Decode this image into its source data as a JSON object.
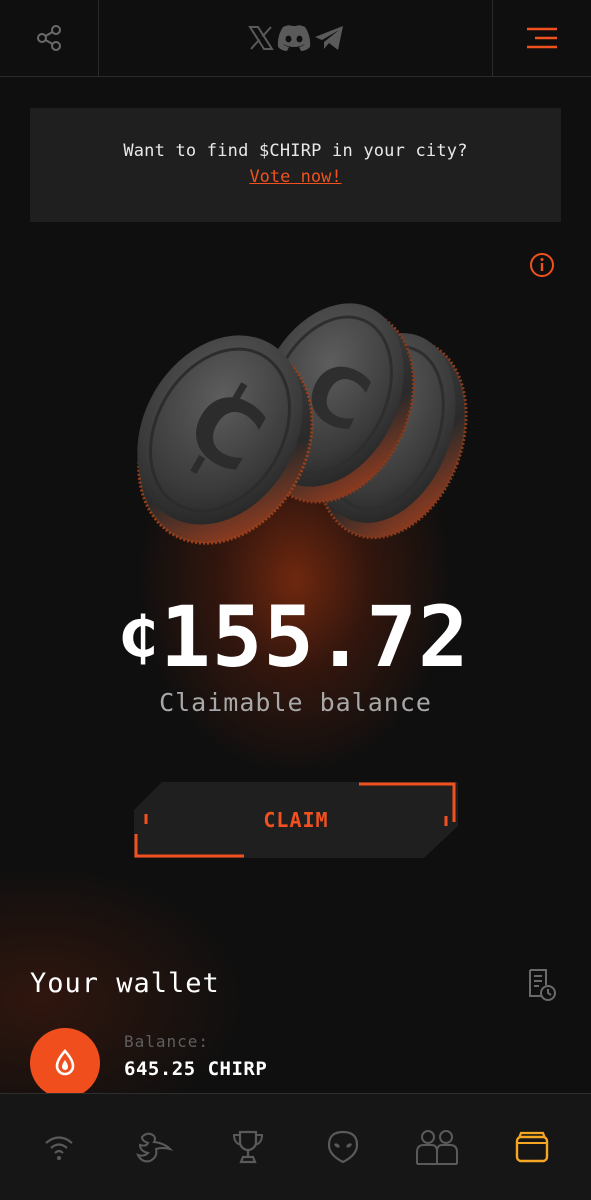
{
  "topbar": {
    "share_icon": "share-icon",
    "social": [
      "x-icon",
      "discord-icon",
      "telegram-icon"
    ],
    "menu_icon": "hamburger-menu-icon"
  },
  "banner": {
    "text": "Want to find $CHIRP in your city?",
    "link": "Vote now!"
  },
  "balance": {
    "symbol": "₵",
    "amount": "155.72",
    "label": "Claimable balance"
  },
  "claim": {
    "label": "CLAIM"
  },
  "wallet": {
    "title": "Your wallet",
    "balance_label": "Balance:",
    "balance_value": "645.25 CHIRP"
  },
  "bottom_nav": [
    "wifi-icon",
    "bird-icon",
    "trophy-icon",
    "alien-icon",
    "people-icon",
    "wallet-icon"
  ],
  "colors": {
    "accent": "#f0511f",
    "background": "#0f0f0f",
    "panel": "#1f1f1f",
    "active_nav": "#f5a623"
  }
}
